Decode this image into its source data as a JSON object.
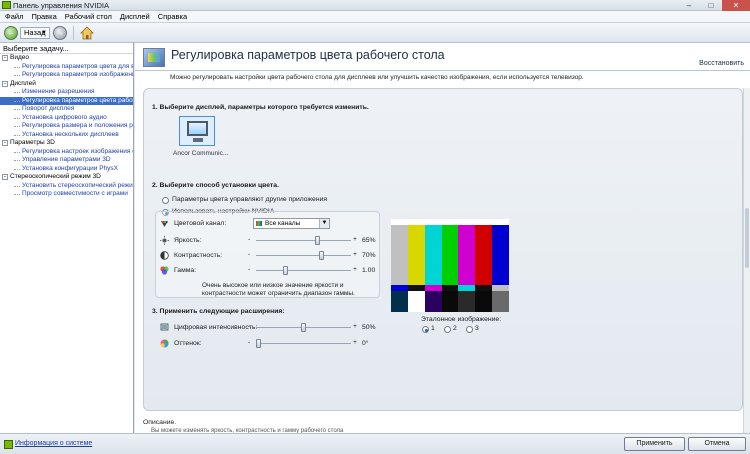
{
  "window": {
    "title": "Панель управления NVIDIA",
    "buttons": [
      "–",
      "□",
      "✕"
    ]
  },
  "menu": [
    "Файл",
    "Правка",
    "Рабочий стол",
    "Дисплей",
    "Справка"
  ],
  "toolbar": {
    "back_label": "Назад",
    "back_icon": "back-arrow-icon",
    "forward_icon": "forward-arrow-icon",
    "home_icon": "home-icon"
  },
  "sidebar": {
    "heading": "Выберите задачу...",
    "groups": [
      {
        "label": "Видео",
        "items": [
          "Регулировка параметров цвета для вид",
          "Регулировка параметров изображения д"
        ]
      },
      {
        "label": "Дисплей",
        "items": [
          "Изменение разрешения",
          "Регулировка параметров цвета рабочего",
          "Поворот дисплея",
          "Установка цифрового аудио",
          "Регулировка размера и положения рабо",
          "Установка нескольких дисплеев"
        ]
      },
      {
        "label": "Параметры 3D",
        "items": [
          "Регулировка настроек изображения с пр",
          "Управление параметрами 3D",
          "Установка конфигурации PhysX"
        ]
      },
      {
        "label": "Стереоскопический режим 3D",
        "items": [
          "Установить стереоскопический режим 3",
          "Просмотр совместимости с играми"
        ]
      }
    ],
    "selected": "Регулировка параметров цвета рабочего"
  },
  "page": {
    "title": "Регулировка параметров цвета рабочего стола",
    "restore_label": "Восстановить",
    "description": "Можно регулировать настройки цвета рабочего стола для дисплеев или улучшить качество изображения, если используется телевизор.",
    "step1": "1. Выберите дисплей, параметры которого требуется изменить.",
    "display_name": "Ancor Communic...",
    "step2": "2. Выберите способ установки цвета.",
    "option_other_apps": "Параметры цвета управляют другие приложения",
    "option_nvidia": "Использовать настройки NVIDIA",
    "channel_label": "Цветовой канал:",
    "channel_value": "Все каналы",
    "brightness": {
      "label": "Яркость:",
      "value": "65%",
      "fraction": 0.65
    },
    "contrast": {
      "label": "Контрастность:",
      "value": "70%",
      "fraction": 0.7
    },
    "gamma": {
      "label": "Гамма:",
      "value": "1.00",
      "fraction": 0.3
    },
    "note": "Очень высокое или низкое значение яркости и контрастности может ограничить диапазон гаммы.",
    "step3": "3. Применить следующие расширения:",
    "digital_vibrance": {
      "label": "Цифровая интенсивность:",
      "value": "50%",
      "fraction": 0.5
    },
    "hue": {
      "label": "Оттенок:",
      "value": "0°",
      "fraction": 0.0
    },
    "reference_label": "Эталонное изображение:",
    "reference_options": [
      "1",
      "2",
      "3"
    ],
    "description_label": "Описание.",
    "description_body": "Вы можете изменять яркость, контрастность и гамму рабочего стола"
  },
  "footer": {
    "system_info": "Информация о системе",
    "apply": "Применить",
    "cancel": "Отмена"
  },
  "colors": {
    "accent": "#3a6ec7",
    "nvidia_green": "#76b900"
  }
}
